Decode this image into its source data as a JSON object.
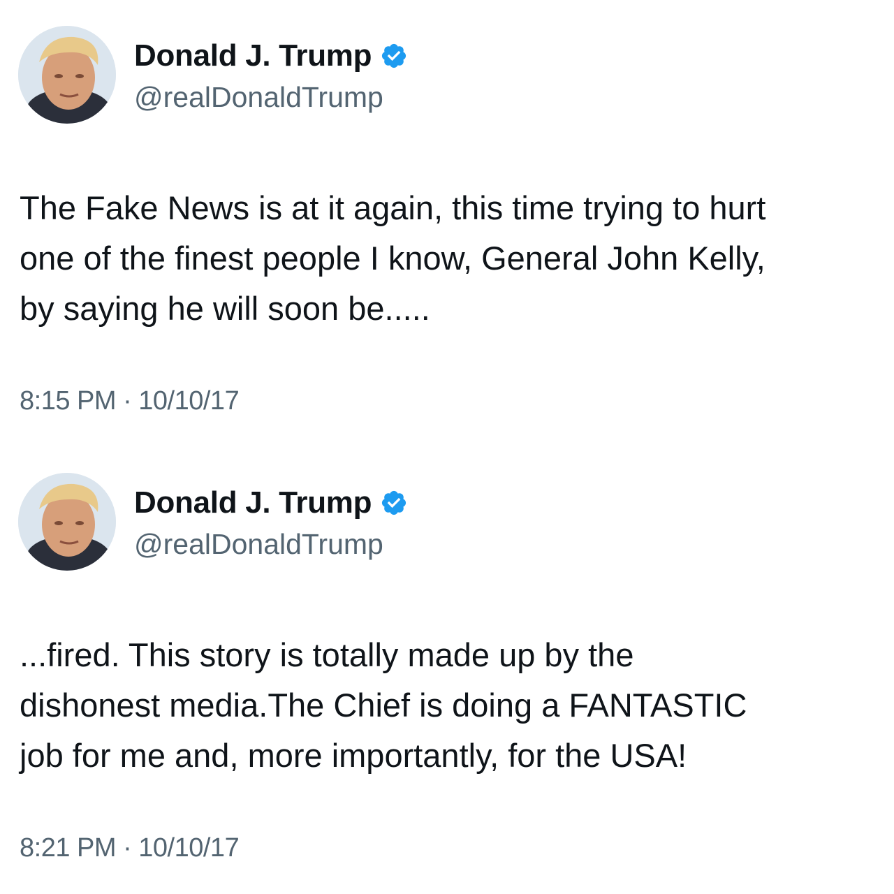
{
  "tweets": [
    {
      "author_name": "Donald J. Trump",
      "handle": "@realDonaldTrump",
      "text": "The Fake News is at it again, this time trying to hurt\none of the finest people I know, General John Kelly,\nby saying he will soon be.....",
      "timestamp": "8:15 PM · 10/10/17",
      "verified_icon": "verified-badge-icon",
      "verified_color": "#1d9bf0"
    },
    {
      "author_name": "Donald J. Trump",
      "handle": "@realDonaldTrump",
      "text": "...fired. This story is totally made up by the\ndishonest media.The Chief is doing a FANTASTIC\njob for me and, more importantly, for the USA!",
      "timestamp": "8:21 PM · 10/10/17",
      "verified_icon": "verified-badge-icon",
      "verified_color": "#1d9bf0"
    }
  ]
}
